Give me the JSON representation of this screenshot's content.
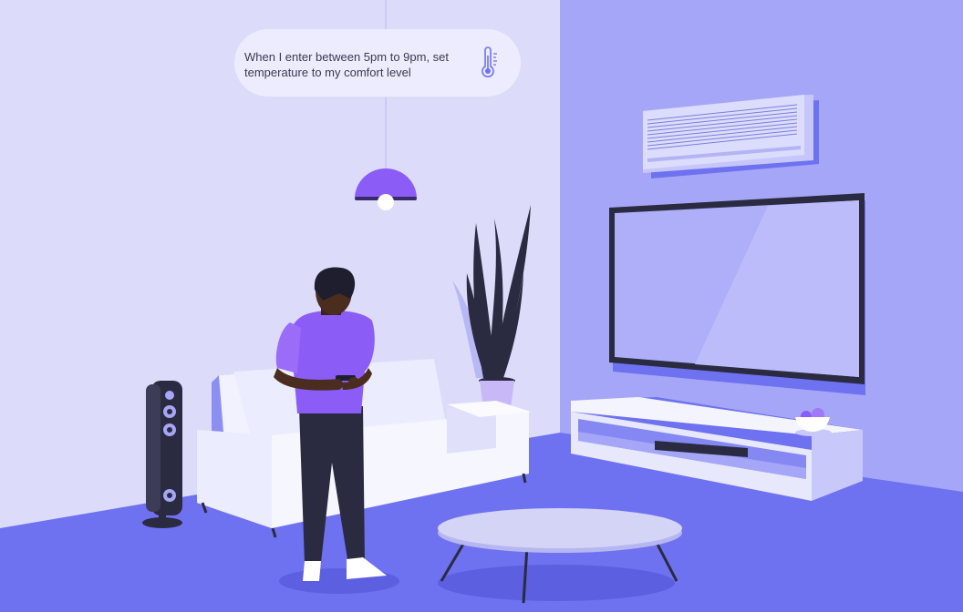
{
  "speech_bubble": {
    "text": "When I enter between 5pm to 9pm, set temperature to my comfort level",
    "icon": "thermometer-icon"
  },
  "palette": {
    "left_wall": "#dcdcfa",
    "right_wall": "#a6a6f8",
    "floor": "#6e71f0",
    "accent": "#8b5cf6",
    "sofa": "#f2f2ff",
    "dark": "#2a2a40"
  }
}
